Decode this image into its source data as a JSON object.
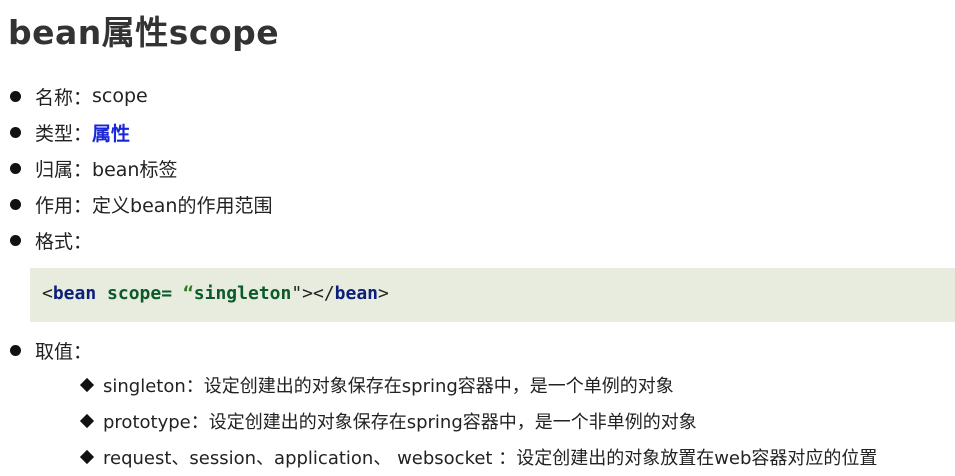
{
  "title": "bean属性scope",
  "items": [
    {
      "label": "名称：",
      "value": "scope"
    },
    {
      "label": "类型：",
      "value": "属性"
    },
    {
      "label": "归属：",
      "value": "bean标签"
    },
    {
      "label": "作用：",
      "value": "定义bean的作用范围"
    },
    {
      "label": "格式：",
      "value": ""
    }
  ],
  "code": {
    "open_bracket": "<",
    "tag": "bean",
    "attr": "scope=",
    "open_quote": "“",
    "string": "singleton",
    "close_quote": "\"",
    "mid": "></",
    "close_tag": "bean",
    "close_bracket": ">"
  },
  "values_label": "取值：",
  "sub_items": [
    "singleton：设定创建出的对象保存在spring容器中，是一个单例的对象",
    "prototype：设定创建出的对象保存在spring容器中，是一个非单例的对象",
    "request、session、application、 websocket ：设定创建出的对象放置在web容器对应的位置"
  ],
  "colors": {
    "accent": "#1a27d6",
    "code_background": "#e7ecdf"
  }
}
